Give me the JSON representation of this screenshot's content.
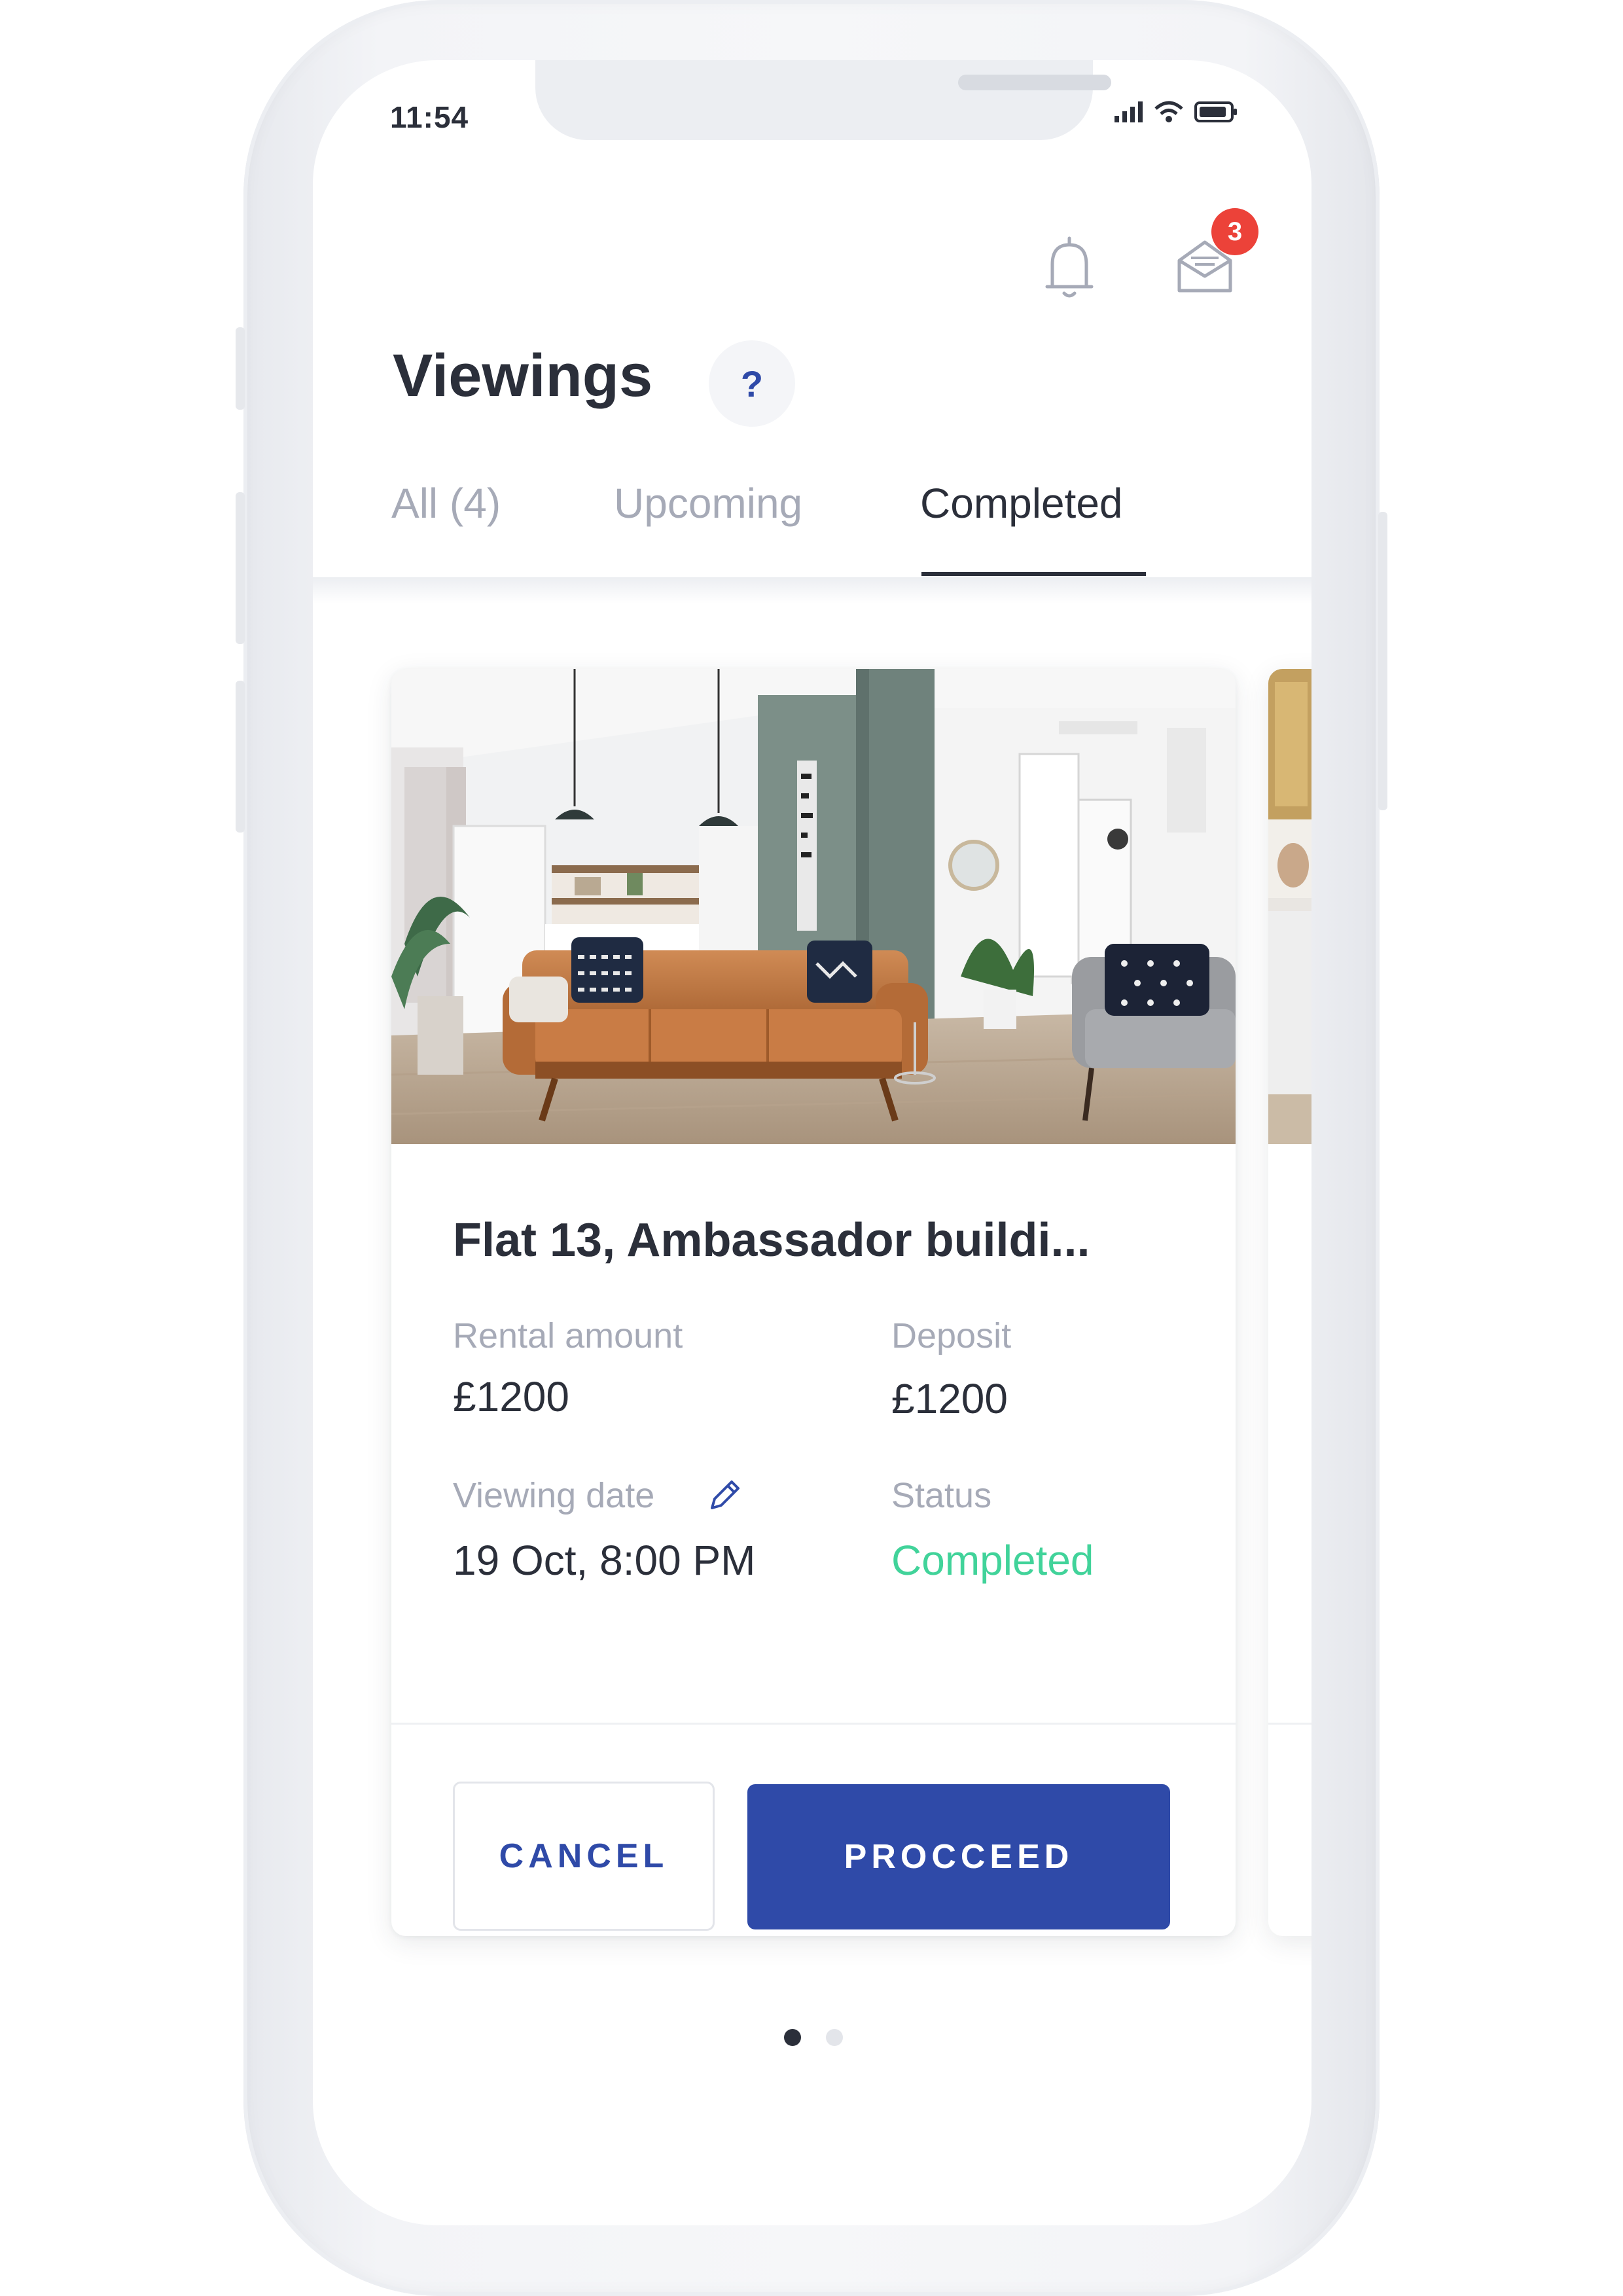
{
  "status_bar": {
    "time": "11:54"
  },
  "header": {
    "notification_icon": "bell-icon",
    "messages_icon": "envelope-icon",
    "messages_badge": "3",
    "title": "Viewings",
    "help_label": "?"
  },
  "tabs": [
    {
      "label": "All (4)",
      "active": false
    },
    {
      "label": "Upcoming",
      "active": false
    },
    {
      "label": "Completed",
      "active": true
    }
  ],
  "card": {
    "title": "Flat 13, Ambassador buildi...",
    "rental_amount_label": "Rental amount",
    "rental_amount": "£1200",
    "deposit_label": "Deposit",
    "deposit": "£1200",
    "viewing_date_label": "Viewing date",
    "viewing_date": "19 Oct, 8:00 PM",
    "status_label": "Status",
    "status": "Completed",
    "cancel_label": "CANCEL",
    "proceed_label": "PROCCEED"
  },
  "pagination": {
    "total": 2,
    "active_index": 0
  },
  "colors": {
    "primary": "#2f4aa8",
    "success": "#41d39a",
    "badge": "#ec4239",
    "text": "#2b2f3a",
    "muted": "#a6aab7"
  }
}
